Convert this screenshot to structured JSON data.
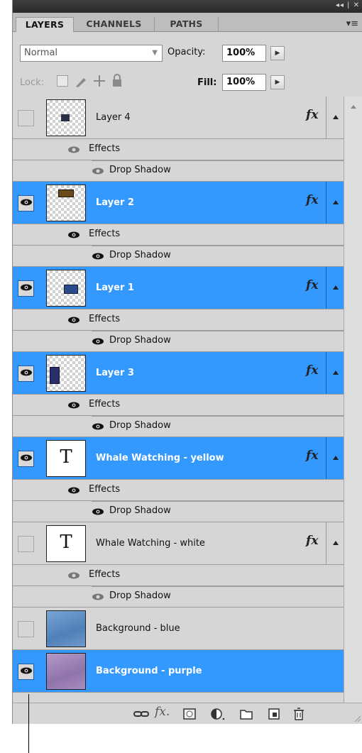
{
  "panel": {
    "title_controls": "◂◂ | ✕",
    "tabs": [
      {
        "label": "LAYERS",
        "active": true
      },
      {
        "label": "CHANNELS",
        "active": false
      },
      {
        "label": "PATHS",
        "active": false
      }
    ],
    "menu_icon": "panel-menu-icon"
  },
  "controls": {
    "blend_mode": "Normal",
    "opacity_label": "Opacity:",
    "opacity_value": "100%",
    "lock_label": "Lock:",
    "fill_label": "Fill:",
    "fill_value": "100%"
  },
  "colors": {
    "selection": "#3399ff",
    "panel_bg": "#d6d6d6"
  },
  "layers": [
    {
      "name": "Layer 4",
      "visible": false,
      "selected": false,
      "kind": "pixel",
      "fx": "fx",
      "effects_label": "Effects",
      "effect": "Drop Shadow"
    },
    {
      "name": "Layer 2",
      "visible": true,
      "selected": true,
      "kind": "pixel",
      "fx": "fx",
      "effects_label": "Effects",
      "effect": "Drop Shadow"
    },
    {
      "name": "Layer 1",
      "visible": true,
      "selected": true,
      "kind": "pixel",
      "fx": "fx",
      "effects_label": "Effects",
      "effect": "Drop Shadow"
    },
    {
      "name": "Layer 3",
      "visible": true,
      "selected": true,
      "kind": "pixel",
      "fx": "fx",
      "effects_label": "Effects",
      "effect": "Drop Shadow"
    },
    {
      "name": "Whale Watching -  yellow",
      "visible": true,
      "selected": true,
      "kind": "text",
      "glyph": "T",
      "fx": "fx",
      "effects_label": "Effects",
      "effect": "Drop Shadow"
    },
    {
      "name": "Whale Watching - white",
      "visible": false,
      "selected": false,
      "kind": "text",
      "glyph": "T",
      "fx": "fx",
      "effects_label": "Effects",
      "effect": "Drop Shadow"
    },
    {
      "name": "Background - blue",
      "visible": false,
      "selected": false,
      "kind": "image"
    },
    {
      "name": "Background - purple",
      "visible": true,
      "selected": true,
      "kind": "image"
    }
  ],
  "bottom_icons": [
    "link-layers-icon",
    "add-style-icon",
    "add-mask-icon",
    "adjustment-layer-icon",
    "new-group-icon",
    "new-layer-icon",
    "delete-layer-icon"
  ]
}
